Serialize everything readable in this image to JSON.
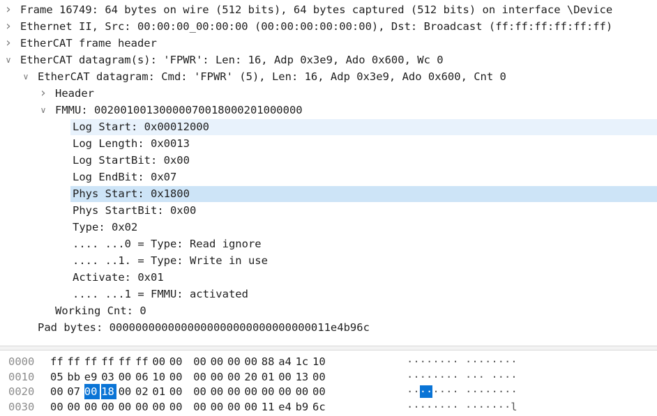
{
  "tree": [
    {
      "text": "Frame 16749: 64 bytes on wire (512 bits), 64 bytes captured (512 bits) on interface \\Device",
      "expander": "collapsed",
      "level": 0
    },
    {
      "text": "Ethernet II, Src: 00:00:00_00:00:00 (00:00:00:00:00:00), Dst: Broadcast (ff:ff:ff:ff:ff:ff)",
      "expander": "collapsed",
      "level": 0
    },
    {
      "text": "EtherCAT frame header",
      "expander": "collapsed",
      "level": 0
    },
    {
      "text": "EtherCAT datagram(s): 'FPWR': Len: 16, Adp 0x3e9, Ado 0x600, Wc 0",
      "expander": "expanded",
      "level": 0
    },
    {
      "text": "EtherCAT datagram: Cmd: 'FPWR' (5), Len: 16, Adp 0x3e9, Ado 0x600, Cnt 0",
      "expander": "expanded",
      "level": 1
    },
    {
      "text": "Header",
      "expander": "collapsed",
      "level": 2
    },
    {
      "text": "FMMU: 00200100130000070018000201000000",
      "expander": "expanded",
      "level": 2
    },
    {
      "text": "Log Start: 0x00012000",
      "expander": "none",
      "level": 3,
      "highlight": "light"
    },
    {
      "text": "Log Length: 0x0013",
      "expander": "none",
      "level": 3
    },
    {
      "text": "Log StartBit: 0x00",
      "expander": "none",
      "level": 3
    },
    {
      "text": "Log EndBit: 0x07",
      "expander": "none",
      "level": 3
    },
    {
      "text": "Phys Start: 0x1800",
      "expander": "none",
      "level": 3,
      "highlight": "selected"
    },
    {
      "text": "Phys StartBit: 0x00",
      "expander": "none",
      "level": 3
    },
    {
      "text": "Type: 0x02",
      "expander": "none",
      "level": 3
    },
    {
      "text": ".... ...0 = Type: Read ignore",
      "expander": "none",
      "level": 3
    },
    {
      "text": ".... ..1. = Type: Write in use",
      "expander": "none",
      "level": 3
    },
    {
      "text": "Activate: 0x01",
      "expander": "none",
      "level": 3
    },
    {
      "text": ".... ...1 = FMMU: activated",
      "expander": "none",
      "level": 3
    },
    {
      "text": "Working Cnt: 0",
      "expander": "none",
      "level": 2
    },
    {
      "text": "Pad bytes: 0000000000000000000000000000000011e4b96c",
      "expander": "none",
      "level": 1
    }
  ],
  "hex": [
    {
      "offset": "0000",
      "bytes": [
        "ff",
        "ff",
        "ff",
        "ff",
        "ff",
        "ff",
        "00",
        "00",
        "00",
        "00",
        "00",
        "00",
        "88",
        "a4",
        "1c",
        "10"
      ],
      "ascii": "········ ········"
    },
    {
      "offset": "0010",
      "bytes": [
        "05",
        "bb",
        "e9",
        "03",
        "00",
        "06",
        "10",
        "00",
        "00",
        "00",
        "00",
        "20",
        "01",
        "00",
        "13",
        "00"
      ],
      "ascii": "········ ··· ····"
    },
    {
      "offset": "0020",
      "bytes": [
        "00",
        "07",
        "00",
        "18",
        "00",
        "02",
        "01",
        "00",
        "00",
        "00",
        "00",
        "00",
        "00",
        "00",
        "00",
        "00"
      ],
      "ascii": "········ ········",
      "selected": [
        2,
        3
      ]
    },
    {
      "offset": "0030",
      "bytes": [
        "00",
        "00",
        "00",
        "00",
        "00",
        "00",
        "00",
        "00",
        "00",
        "00",
        "00",
        "00",
        "11",
        "e4",
        "b9",
        "6c"
      ],
      "ascii": "········ ·······l"
    }
  ]
}
